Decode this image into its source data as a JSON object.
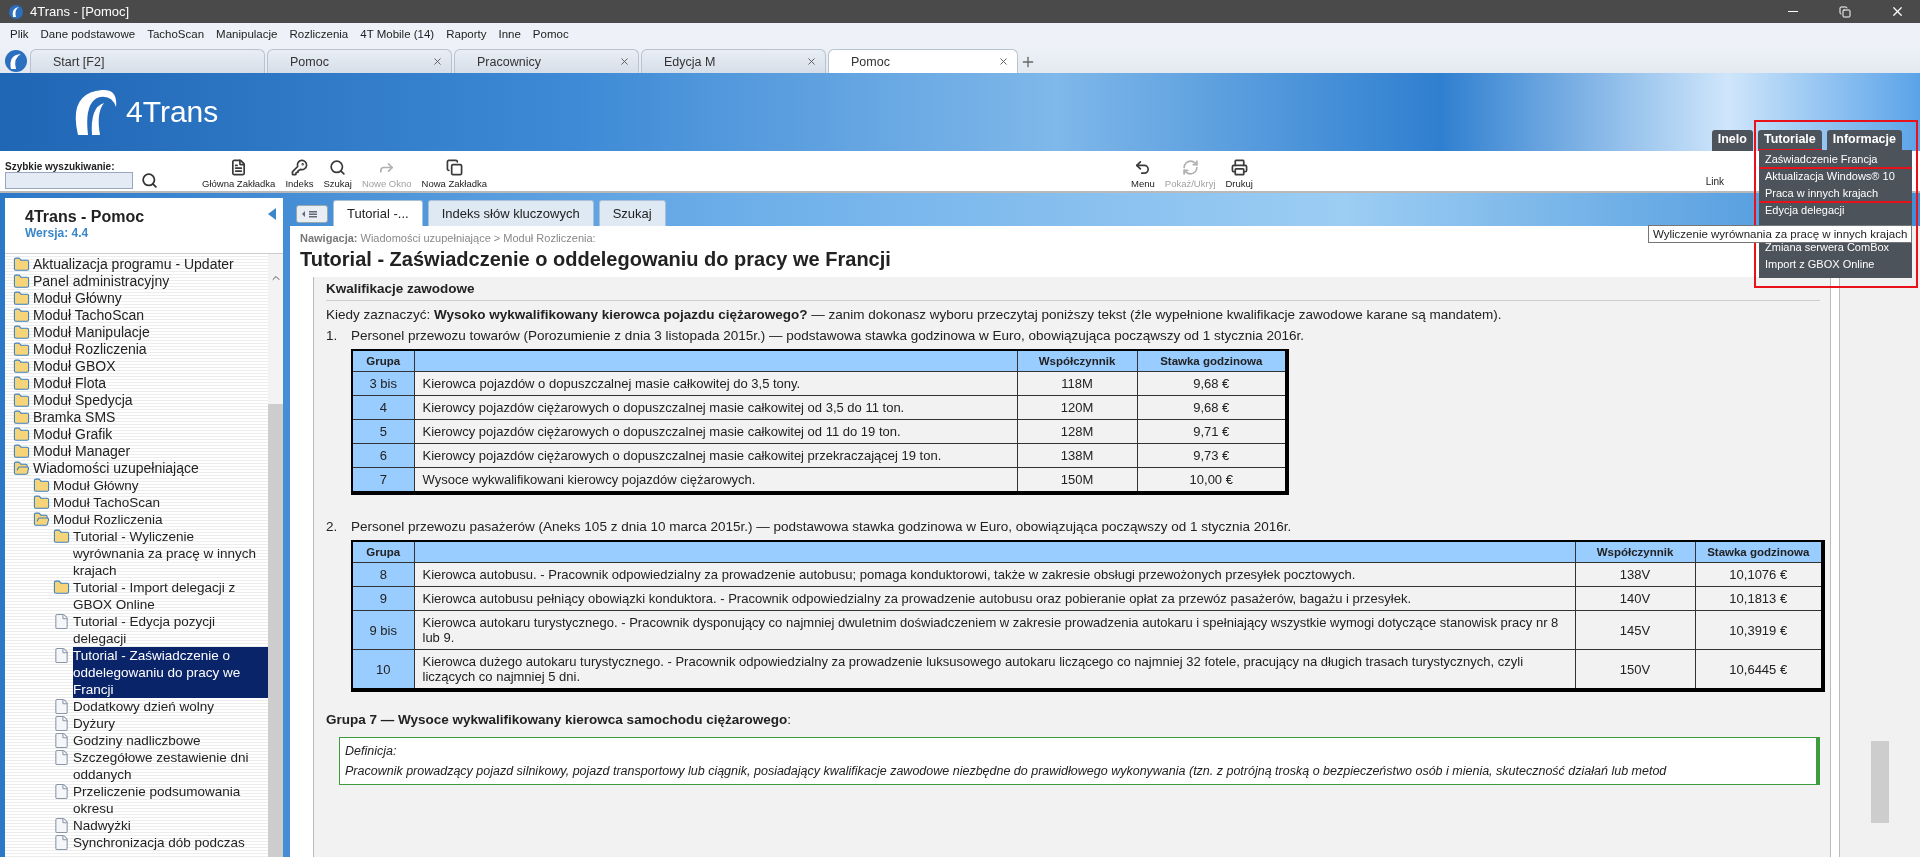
{
  "window": {
    "title": "4Trans - [Pomoc]"
  },
  "menu_bar": [
    "Plik",
    "Dane podstawowe",
    "TachoScan",
    "Manipulacje",
    "Rozliczenia",
    "4T Mobile (14)",
    "Raporty",
    "Inne",
    "Pomoc"
  ],
  "tabs": [
    {
      "label": "Start [F2]",
      "closable": false,
      "selected": false
    },
    {
      "label": "Pomoc",
      "closable": true,
      "selected": false
    },
    {
      "label": "Pracownicy",
      "closable": true,
      "selected": false
    },
    {
      "label": "Edycja M",
      "closable": true,
      "selected": false
    },
    {
      "label": "Pomoc",
      "closable": true,
      "selected": true
    }
  ],
  "banner": {
    "logo": "4Trans"
  },
  "header_tabs": [
    {
      "label": "Inelo",
      "marked": false
    },
    {
      "label": "Tutoriale",
      "marked": true
    },
    {
      "label": "Informacje",
      "marked": false
    }
  ],
  "tutorial_menu": {
    "highlighted": true,
    "items": [
      {
        "label": "Zaświadczenie Francja",
        "marked": true
      },
      {
        "label": "Aktualizacja Windows® 10",
        "marked": false
      },
      {
        "label": "Praca w innych krajach",
        "marked": true
      },
      {
        "label": "Edycja delegacji",
        "marked": false
      },
      {
        "label": "Zmiana serwera ComBox",
        "marked": false
      },
      {
        "label": "Import z GBOX Online",
        "marked": false
      }
    ]
  },
  "tooltip": "Wyliczenie wyrównania za pracę w innych krajach",
  "quick_search": {
    "label": "Szybkie wyszukiwanie:"
  },
  "toolbar": [
    {
      "label": "Główna Zakładka",
      "kind": "document",
      "disabled": false
    },
    {
      "label": "Indeks",
      "kind": "key",
      "disabled": false
    },
    {
      "label": "Szukaj",
      "kind": "search",
      "disabled": false
    },
    {
      "label": "Nowe Okno",
      "kind": "forward",
      "disabled": true
    },
    {
      "label": "Nowa Zakładka",
      "kind": "copy",
      "disabled": false
    }
  ],
  "toolbar_right": [
    {
      "label": "Menu",
      "kind": "undo",
      "disabled": false
    },
    {
      "label": "Pokaż/Ukryj",
      "kind": "refresh",
      "disabled": true
    },
    {
      "label": "Drukuj",
      "kind": "printer",
      "disabled": false
    }
  ],
  "link_label": "Link",
  "sidebar": {
    "title": "4Trans - Pomoc",
    "version": "Wersja: 4.4",
    "tree": [
      {
        "label": "Aktualizacja programu - Updater",
        "kind": "folder",
        "expanded": false,
        "selected": false
      },
      {
        "label": "Panel administracyjny",
        "kind": "folder",
        "expanded": false,
        "selected": false
      },
      {
        "label": "Moduł Główny",
        "kind": "folder",
        "expanded": false,
        "selected": false
      },
      {
        "label": "Moduł TachoScan",
        "kind": "folder",
        "expanded": false,
        "selected": false
      },
      {
        "label": "Moduł Manipulacje",
        "kind": "folder",
        "expanded": false,
        "selected": false
      },
      {
        "label": "Moduł Rozliczenia",
        "kind": "folder",
        "expanded": false,
        "selected": false
      },
      {
        "label": "Moduł GBOX",
        "kind": "folder",
        "expanded": false,
        "selected": false
      },
      {
        "label": "Moduł Flota",
        "kind": "folder",
        "expanded": false,
        "selected": false
      },
      {
        "label": "Moduł Spedycja",
        "kind": "folder",
        "expanded": false,
        "selected": false
      },
      {
        "label": "Bramka SMS",
        "kind": "folder",
        "expanded": false,
        "selected": false
      },
      {
        "label": "Moduł Grafik",
        "kind": "folder",
        "expanded": false,
        "selected": false
      },
      {
        "label": "Moduł Manager",
        "kind": "folder",
        "expanded": false,
        "selected": false
      },
      {
        "label": "Wiadomości uzupełniające",
        "kind": "folder",
        "expanded": true,
        "selected": false,
        "children": [
          {
            "label": "Moduł Główny",
            "kind": "folder",
            "expanded": false,
            "selected": false
          },
          {
            "label": "Moduł TachoScan",
            "kind": "folder",
            "expanded": false,
            "selected": false
          },
          {
            "label": "Moduł Rozliczenia",
            "kind": "folder",
            "expanded": true,
            "selected": false,
            "children": [
              {
                "label": "Tutorial - Wyliczenie wyrównania za pracę w innych krajach",
                "kind": "folder",
                "expanded": false,
                "selected": false
              },
              {
                "label": "Tutorial - Import delegacji z GBOX Online",
                "kind": "folder",
                "expanded": false,
                "selected": false
              },
              {
                "label": "Tutorial - Edycja pozycji delegacji",
                "kind": "page",
                "selected": false
              },
              {
                "label": "Tutorial - Zaświadczenie o oddelegowaniu do pracy we Francji",
                "kind": "page",
                "selected": true
              },
              {
                "label": "Dodatkowy dzień wolny",
                "kind": "page",
                "selected": false
              },
              {
                "label": "Dyżury",
                "kind": "page",
                "selected": false
              },
              {
                "label": "Godziny nadliczbowe",
                "kind": "page",
                "selected": false
              },
              {
                "label": "Szczegółowe zestawienie dni oddanych",
                "kind": "page",
                "selected": false
              },
              {
                "label": "Przeliczenie podsumowania okresu",
                "kind": "page",
                "selected": false
              },
              {
                "label": "Nadwyżki",
                "kind": "page",
                "selected": false
              },
              {
                "label": "Synchronizacja dób podczas",
                "kind": "page",
                "selected": false
              }
            ]
          }
        ]
      }
    ]
  },
  "help_tabs": [
    {
      "label": "Tutorial -...",
      "selected": true
    },
    {
      "label": "Indeks słów kluczowych",
      "selected": false
    },
    {
      "label": "Szukaj",
      "selected": false
    }
  ],
  "navigation": {
    "label": "Nawigacja:",
    "path": "Wiadomości uzupełniające > Moduł Rozliczenia:"
  },
  "page_title": "Tutorial - Zaświadczenie o oddelegowaniu do pracy we Francji",
  "section_heading": "Kwalifikacje zawodowe",
  "intro": "Kiedy zaznaczyć: **Wysoko wykwalifikowany kierowca pojazdu ciężarowego?** — zanim dokonasz wyboru przeczytaj poniższy tekst (źle wypełnione kwalifikacje zawodowe karane są mandatem).",
  "lists": [
    {
      "number": "1.",
      "text": "Personel przewozu towarów (Porozumienie z dnia 3 listopada 2015r.) — podstawowa stawka godzinowa w Euro, obowiązująca począwszy od 1 stycznia 2016r.",
      "table": {
        "wide": false,
        "columns": {
          "group": "Grupa",
          "factor": "Współczynnik",
          "rate": "Stawka godzinowa"
        },
        "rows": [
          {
            "group": "3 bis",
            "description": "Kierowca pojazdów o dopuszczalnej masie całkowitej do 3,5 tony.",
            "factor": "118M",
            "rate": "9,68 €"
          },
          {
            "group": "4",
            "description": "Kierowcy pojazdów ciężarowych o dopuszczalnej masie całkowitej od 3,5 do 11 ton.",
            "factor": "120M",
            "rate": "9,68 €"
          },
          {
            "group": "5",
            "description": "Kierowcy pojazdów ciężarowych o dopuszczalnej masie całkowitej od 11 do 19 ton.",
            "factor": "128M",
            "rate": "9,71 €"
          },
          {
            "group": "6",
            "description": "Kierowcy pojazdów ciężarowych o dopuszczalnej masie całkowitej przekraczającej 19 ton.",
            "factor": "138M",
            "rate": "9,73 €"
          },
          {
            "group": "7",
            "description": "Wysoce wykwalifikowani kierowcy pojazdów ciężarowych.",
            "factor": "150M",
            "rate": "10,00 €"
          }
        ]
      }
    },
    {
      "number": "2.",
      "text": "Personel przewozu pasażerów (Aneks 105 z dnia 10 marca 2015r.) — podstawowa stawka godzinowa w Euro, obowiązująca począwszy od 1 stycznia 2016r.",
      "table": {
        "wide": true,
        "columns": {
          "group": "Grupa",
          "factor": "Współczynnik",
          "rate": "Stawka godzinowa"
        },
        "rows": [
          {
            "group": "8",
            "description": "Kierowca autobusu. - Pracownik odpowiedzialny za prowadzenie autobusu; pomaga konduktorowi, także w zakresie obsługi przewożonych przesyłek pocztowych.",
            "factor": "138V",
            "rate": "10,1076 €"
          },
          {
            "group": "9",
            "description": "Kierowca autobusu pełniący obowiązki konduktora. - Pracownik odpowiedzialny za prowadzenie autobusu oraz pobieranie opłat za przewóz pasażerów, bagażu i przesyłek.",
            "factor": "140V",
            "rate": "10,1813 €"
          },
          {
            "group": "9 bis",
            "description": "Kierowca autokaru turystycznego. - Pracownik dysponujący co najmniej dwuletnim doświadczeniem w zakresie prowadzenia autokaru i spełniający wszystkie wymogi dotyczące stanowisk pracy nr 8 lub 9.",
            "factor": "145V",
            "rate": "10,3919 €"
          },
          {
            "group": "10",
            "description": "Kierowca dużego autokaru turystycznego. - Pracownik odpowiedzialny za prowadzenie luksusowego autokaru liczącego co najmniej 32 fotele, pracujący na długich trasach turystycznych, czyli liczących co najmniej 5 dni.",
            "factor": "150V",
            "rate": "10,6445 €"
          }
        ]
      }
    }
  ],
  "group7_heading": "**Grupa 7 — Wysoce wykwalifikowany kierowca samochodu ciężarowego**:",
  "definition": {
    "label": "Definicja:",
    "text": "Pracownik prowadzący pojazd silnikowy, pojazd transportowy lub ciągnik, posiadający kwalifikacje zawodowe niezbędne do prawidłowego wykonywania (tzn. z potrójną troską o bezpieczeństwo osób i mienia, skuteczność działań lub metod"
  }
}
